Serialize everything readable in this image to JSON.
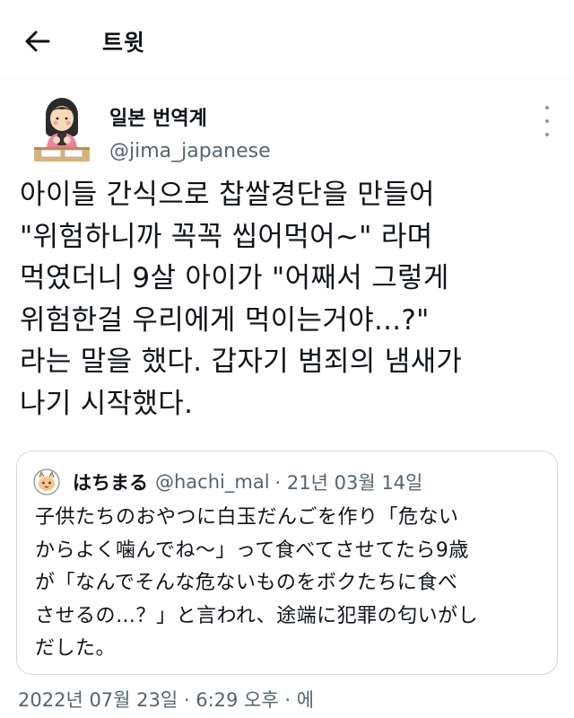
{
  "header": {
    "title": "트윗"
  },
  "tweet": {
    "author_name": "일본 번역계",
    "author_handle": "@jima_japanese",
    "text": "아이들 간식으로 찹쌀경단을 만들어\n\"위험하니까 꼭꼭 씹어먹어~\" 라며\n먹였더니 9살 아이가 \"어째서 그렇게\n위험한걸 우리에게 먹이는거야...?\"\n라는 말을 했다. 갑자기 범죄의 냄새가\n나기 시작했다.",
    "timestamp": "2022년 07월 23일 · 6:29 오후 · 에"
  },
  "quote": {
    "author_name": "はちまる",
    "author_handle": "@hachi_mal",
    "date": "· 21년 03월 14일",
    "text": "子供たちのおやつに白玉だんごを作り「危ない\nからよく噛んでね〜」って食べてさせてたら9歳\nが「なんでそんな危ないものをボクたちに食べ\nさせるの…？」と言われ、途端に犯罪の匂いがし\nだした。"
  }
}
